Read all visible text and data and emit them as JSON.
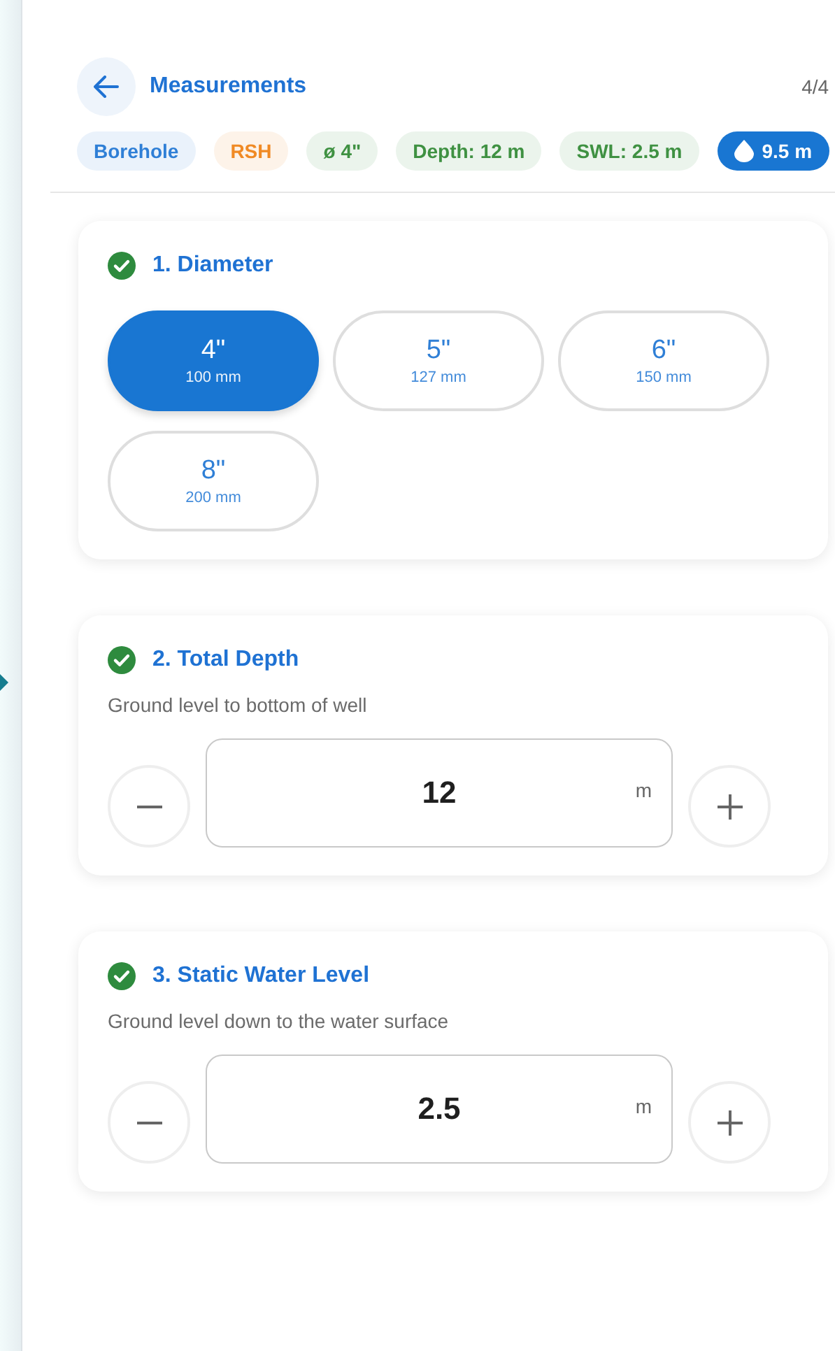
{
  "header": {
    "title": "Measurements",
    "step": "4/4"
  },
  "chips": [
    {
      "label": "Borehole",
      "kind": "tag",
      "color": "#2f7fd6"
    },
    {
      "label": "RSH",
      "kind": "tag",
      "color": "#f08a24"
    },
    {
      "label": "ø 4\"",
      "kind": "tag",
      "color": "#3f9142"
    },
    {
      "label": "Depth: 12 m",
      "kind": "tag",
      "color": "#3f9142"
    },
    {
      "label": "SWL: 2.5 m",
      "kind": "tag",
      "color": "#3f9142"
    },
    {
      "label": "9.5 m",
      "kind": "water",
      "color": "#1976d2"
    }
  ],
  "sections": [
    {
      "title": "1. Diameter",
      "done": true,
      "kind": "options",
      "options": [
        {
          "label": "4\"",
          "sub": "100 mm",
          "selected": true
        },
        {
          "label": "5\"",
          "sub": "127 mm",
          "selected": false
        },
        {
          "label": "6\"",
          "sub": "150 mm",
          "selected": false
        },
        {
          "label": "8\"",
          "sub": "200 mm",
          "selected": false
        }
      ]
    },
    {
      "title": "2. Total Depth",
      "done": true,
      "kind": "stepper",
      "description": "Ground level to bottom of well",
      "value": "12",
      "unit": "m"
    },
    {
      "title": "3. Static Water Level",
      "done": true,
      "kind": "stepper",
      "description": "Ground level down to the water surface",
      "value": "2.5",
      "unit": "m"
    }
  ]
}
